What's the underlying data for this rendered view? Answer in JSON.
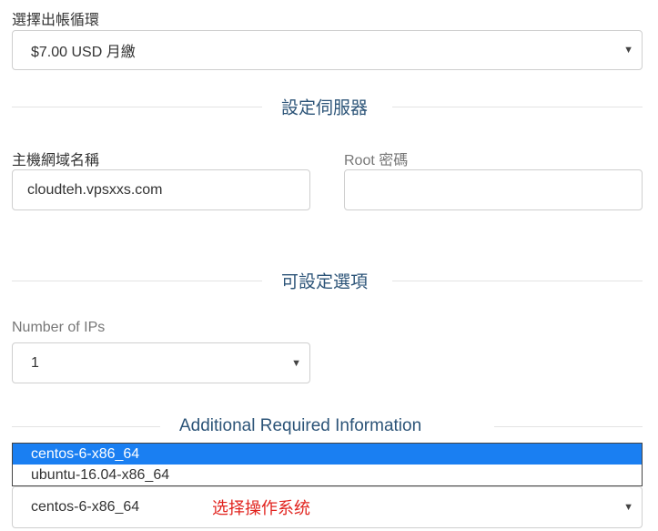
{
  "billing": {
    "label": "選擇出帳循環",
    "selected": "$7.00 USD 月繳"
  },
  "configure_server": {
    "title": "設定伺服器",
    "hostname_label": "主機網域名稱",
    "hostname_value": "cloudteh.vpsxxs.com",
    "root_password_label": "Root 密碼",
    "root_password_value": ""
  },
  "configurable_options": {
    "title": "可設定選項",
    "ips_label": "Number of IPs",
    "ips_value": "1"
  },
  "additional_info": {
    "title": "Additional Required Information",
    "os_options": [
      "centos-6-x86_64",
      "ubuntu-16.04-x86_64"
    ],
    "os_selected": "centos-6-x86_64",
    "annotation": "选择操作系统"
  },
  "colors": {
    "section_title": "#2c5478",
    "dropdown_highlight": "#1a7ff2",
    "annotation": "#e1231e"
  },
  "icons": {
    "select_caret": "caret-down-icon"
  }
}
